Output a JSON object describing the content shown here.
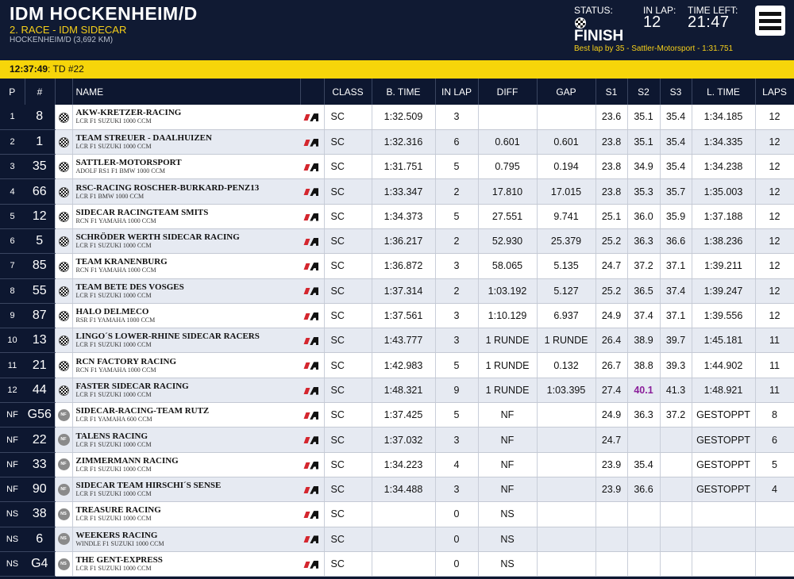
{
  "header": {
    "title": "IDM HOCKENHEIM/D",
    "subtitle": "2. RACE - IDM SIDECAR",
    "track": "HOCKENHEIM/D (3,692 KM)",
    "status_label": "STATUS:",
    "status_value": "FINISH",
    "inlap_label": "IN LAP:",
    "inlap_value": "12",
    "timeleft_label": "TIME LEFT:",
    "timeleft_value": "21:47",
    "best_lap": "Best lap by 35 - Sattler-Motorsport - 1:31.751"
  },
  "info_bar": {
    "time": "12:37:49",
    "message": ": TD #22"
  },
  "columns": [
    "P",
    "#",
    "",
    "NAME",
    "",
    "CLASS",
    "B. TIME",
    "IN LAP",
    "DIFF",
    "GAP",
    "S1",
    "S2",
    "S3",
    "L. TIME",
    "LAPS"
  ],
  "rows": [
    {
      "pos": "1",
      "num": "8",
      "status": "flag",
      "team": "AKW-KRETZER-RACING",
      "bike": "LCR F1 SUZUKI 1000 CCM",
      "cls": "SC",
      "btime": "1:32.509",
      "inlap": "3",
      "diff": "",
      "gap": "",
      "s1": "23.6",
      "s2": "35.1",
      "s3": "35.4",
      "ltime": "1:34.185",
      "laps": "12"
    },
    {
      "pos": "2",
      "num": "1",
      "status": "flag",
      "team": "TEAM STREUER - DAALHUIZEN",
      "bike": "LCR F1 SUZUKI 1000 CCM",
      "cls": "SC",
      "btime": "1:32.316",
      "inlap": "6",
      "diff": "0.601",
      "gap": "0.601",
      "s1": "23.8",
      "s2": "35.1",
      "s3": "35.4",
      "ltime": "1:34.335",
      "laps": "12"
    },
    {
      "pos": "3",
      "num": "35",
      "status": "flag",
      "team": "SATTLER-MOTORSPORT",
      "bike": "ADOLF RS1 F1 BMW 1000 CCM",
      "cls": "SC",
      "btime": "1:31.751",
      "inlap": "5",
      "diff": "0.795",
      "gap": "0.194",
      "s1": "23.8",
      "s2": "34.9",
      "s3": "35.4",
      "ltime": "1:34.238",
      "laps": "12"
    },
    {
      "pos": "4",
      "num": "66",
      "status": "flag",
      "team": "RSC-RACING ROSCHER-BURKARD-PENZ13",
      "bike": "LCR F1 BMW 1000 CCM",
      "cls": "SC",
      "btime": "1:33.347",
      "inlap": "2",
      "diff": "17.810",
      "gap": "17.015",
      "s1": "23.8",
      "s2": "35.3",
      "s3": "35.7",
      "ltime": "1:35.003",
      "laps": "12"
    },
    {
      "pos": "5",
      "num": "12",
      "status": "flag",
      "team": "SIDECAR RACINGTEAM SMITS",
      "bike": "RCN F1 YAMAHA 1000 CCM",
      "cls": "SC",
      "btime": "1:34.373",
      "inlap": "5",
      "diff": "27.551",
      "gap": "9.741",
      "s1": "25.1",
      "s2": "36.0",
      "s3": "35.9",
      "ltime": "1:37.188",
      "laps": "12"
    },
    {
      "pos": "6",
      "num": "5",
      "status": "flag",
      "team": "SCHRÖDER WERTH SIDECAR RACING",
      "bike": "LCR F1 SUZUKI 1000 CCM",
      "cls": "SC",
      "btime": "1:36.217",
      "inlap": "2",
      "diff": "52.930",
      "gap": "25.379",
      "s1": "25.2",
      "s2": "36.3",
      "s3": "36.6",
      "ltime": "1:38.236",
      "laps": "12"
    },
    {
      "pos": "7",
      "num": "85",
      "status": "flag",
      "team": "TEAM KRANENBURG",
      "bike": "RCN F1 YAMAHA 1000 CCM",
      "cls": "SC",
      "btime": "1:36.872",
      "inlap": "3",
      "diff": "58.065",
      "gap": "5.135",
      "s1": "24.7",
      "s2": "37.2",
      "s3": "37.1",
      "ltime": "1:39.211",
      "laps": "12"
    },
    {
      "pos": "8",
      "num": "55",
      "status": "flag",
      "team": "TEAM BETE DES VOSGES",
      "bike": "LCR F1 SUZUKI 1000 CCM",
      "cls": "SC",
      "btime": "1:37.314",
      "inlap": "2",
      "diff": "1:03.192",
      "gap": "5.127",
      "s1": "25.2",
      "s2": "36.5",
      "s3": "37.4",
      "ltime": "1:39.247",
      "laps": "12"
    },
    {
      "pos": "9",
      "num": "87",
      "status": "flag",
      "team": "HALO DELMECO",
      "bike": "RSR F1 YAMAHA 1000 CCM",
      "cls": "SC",
      "btime": "1:37.561",
      "inlap": "3",
      "diff": "1:10.129",
      "gap": "6.937",
      "s1": "24.9",
      "s2": "37.4",
      "s3": "37.1",
      "ltime": "1:39.556",
      "laps": "12"
    },
    {
      "pos": "10",
      "num": "13",
      "status": "flag",
      "team": "LINGO´S LOWER-RHINE SIDECAR RACERS",
      "bike": "LCR F1 SUZUKI 1000 CCM",
      "cls": "SC",
      "btime": "1:43.777",
      "inlap": "3",
      "diff": "1 RUNDE",
      "gap": "1 RUNDE",
      "s1": "26.4",
      "s2": "38.9",
      "s3": "39.7",
      "ltime": "1:45.181",
      "laps": "11"
    },
    {
      "pos": "11",
      "num": "21",
      "status": "flag",
      "team": "RCN FACTORY RACING",
      "bike": "RCN F1 YAMAHA 1000 CCM",
      "cls": "SC",
      "btime": "1:42.983",
      "inlap": "5",
      "diff": "1 RUNDE",
      "gap": "0.132",
      "s1": "26.7",
      "s2": "38.8",
      "s3": "39.3",
      "ltime": "1:44.902",
      "laps": "11"
    },
    {
      "pos": "12",
      "num": "44",
      "status": "flag",
      "team": "FASTER SIDECAR RACING",
      "bike": "LCR F1 SUZUKI 1000 CCM",
      "cls": "SC",
      "btime": "1:48.321",
      "inlap": "9",
      "diff": "1 RUNDE",
      "gap": "1:03.395",
      "s1": "27.4",
      "s2": "40.1",
      "s3": "41.3",
      "ltime": "1:48.921",
      "laps": "11",
      "s2_best": true
    },
    {
      "pos": "NF",
      "num": "G56",
      "status": "NF",
      "team": "SIDECAR-RACING-TEAM RUTZ",
      "bike": "LCR F1 YAMAHA 600 CCM",
      "cls": "SC",
      "btime": "1:37.425",
      "inlap": "5",
      "diff": "NF",
      "gap": "",
      "s1": "24.9",
      "s2": "36.3",
      "s3": "37.2",
      "ltime": "GESTOPPT",
      "laps": "8"
    },
    {
      "pos": "NF",
      "num": "22",
      "status": "NF",
      "team": "TALENS RACING",
      "bike": "LCR F1 SUZUKI 1000 CCM",
      "cls": "SC",
      "btime": "1:37.032",
      "inlap": "3",
      "diff": "NF",
      "gap": "",
      "s1": "24.7",
      "s2": "",
      "s3": "",
      "ltime": "GESTOPPT",
      "laps": "6"
    },
    {
      "pos": "NF",
      "num": "33",
      "status": "NF",
      "team": "ZIMMERMANN RACING",
      "bike": "LCR F1 SUZUKI 1000 CCM",
      "cls": "SC",
      "btime": "1:34.223",
      "inlap": "4",
      "diff": "NF",
      "gap": "",
      "s1": "23.9",
      "s2": "35.4",
      "s3": "",
      "ltime": "GESTOPPT",
      "laps": "5"
    },
    {
      "pos": "NF",
      "num": "90",
      "status": "NF",
      "team": "SIDECAR TEAM HIRSCHI´S SENSE",
      "bike": "LCR F1 SUZUKI 1000 CCM",
      "cls": "SC",
      "btime": "1:34.488",
      "inlap": "3",
      "diff": "NF",
      "gap": "",
      "s1": "23.9",
      "s2": "36.6",
      "s3": "",
      "ltime": "GESTOPPT",
      "laps": "4"
    },
    {
      "pos": "NS",
      "num": "38",
      "status": "NS",
      "team": "TREASURE RACING",
      "bike": "LCR F1 SUZUKI 1000 CCM",
      "cls": "SC",
      "btime": "",
      "inlap": "0",
      "diff": "NS",
      "gap": "",
      "s1": "",
      "s2": "",
      "s3": "",
      "ltime": "",
      "laps": ""
    },
    {
      "pos": "NS",
      "num": "6",
      "status": "NS",
      "team": "WEEKERS RACING",
      "bike": "WINDLE F1 SUZUKI 1000 CCM",
      "cls": "SC",
      "btime": "",
      "inlap": "0",
      "diff": "NS",
      "gap": "",
      "s1": "",
      "s2": "",
      "s3": "",
      "ltime": "",
      "laps": ""
    },
    {
      "pos": "NS",
      "num": "G4",
      "status": "NS",
      "team": "THE GENT-EXPRESS",
      "bike": "LCR F1 SUZUKI 1000 CCM",
      "cls": "SC",
      "btime": "",
      "inlap": "0",
      "diff": "NS",
      "gap": "",
      "s1": "",
      "s2": "",
      "s3": "",
      "ltime": "",
      "laps": ""
    }
  ],
  "icons": {
    "menu": "hamburger-menu-icon",
    "status_flag": "checkered-flag-icon",
    "manufacturer": "brand-logo-icon"
  },
  "colors": {
    "bg": "#0d1730",
    "accent": "#f6d50a",
    "subtitle": "#f5cf1a",
    "best_sector": "#8a1f9a"
  }
}
